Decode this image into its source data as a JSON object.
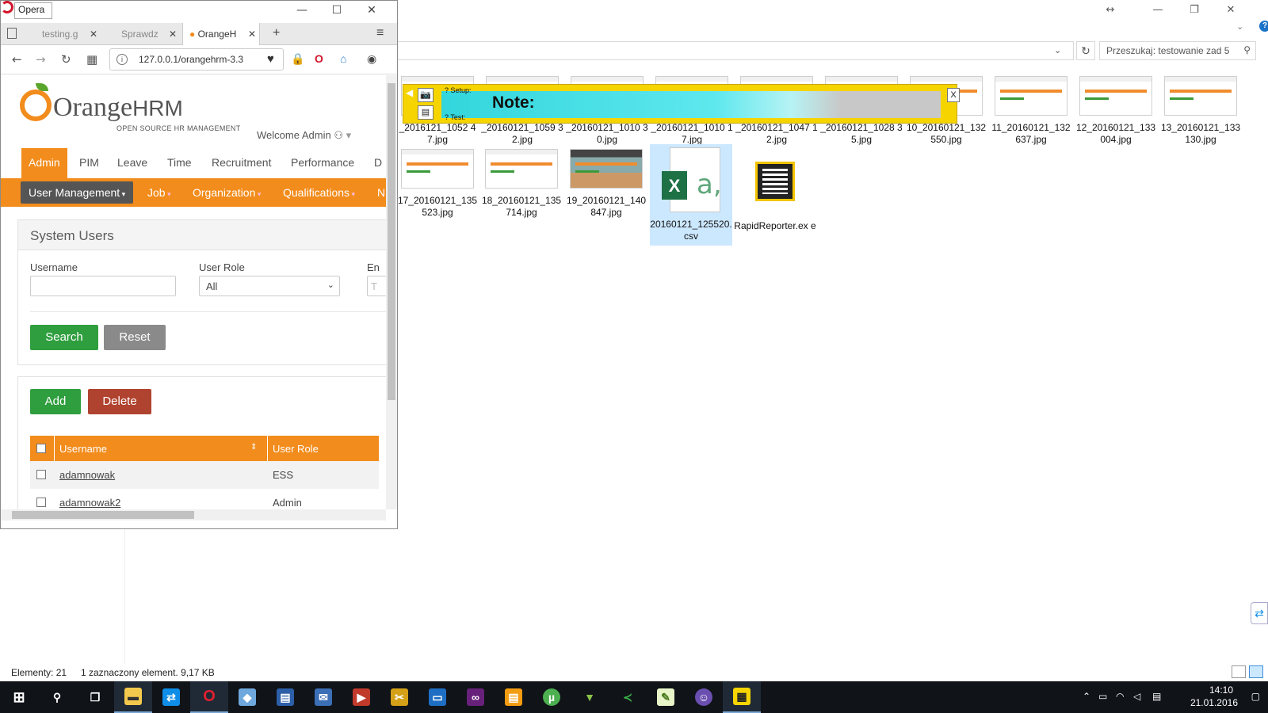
{
  "explorer": {
    "search_placeholder": "Przeszukaj: testowanie zad 5",
    "status_count": "Elementy: 21",
    "status_selected": "1 zaznaczony element. 9,17 KB",
    "row1_files": [
      "_2016121_1052 47.jpg",
      "_20160121_1059 32.jpg",
      "_20160121_1010 30.jpg",
      "_20160121_1010 17.jpg",
      "_20160121_1047 12.jpg",
      "_20160121_1028 35.jpg",
      "10_20160121_132 550.jpg",
      "11_20160121_132 637.jpg",
      "12_20160121_133 004.jpg",
      "13_20160121_133 130.jpg"
    ],
    "row2_files": [
      "17_20160121_135 523.jpg",
      "18_20160121_135 714.jpg",
      "19_20160121_140 847.jpg",
      "20160121_125520. csv",
      "RapidReporter.ex e"
    ]
  },
  "rapidreporter": {
    "setup_label": "? Setup:",
    "test_label": "? Test:",
    "note_label": "Note:",
    "close_label": "X"
  },
  "opera": {
    "title": "Opera",
    "tabs": [
      {
        "label": "testing.g"
      },
      {
        "label": "Sprawdz"
      },
      {
        "label": "OrangeH"
      }
    ],
    "url": "127.0.0.1/orangehrm-3.3"
  },
  "ohrm": {
    "logo_text": "Orange",
    "logo_hrm": "HRM",
    "logo_tagline": "OPEN SOURCE HR MANAGEMENT",
    "welcome": "Welcome Admin",
    "main_menu": [
      "Admin",
      "PIM",
      "Leave",
      "Time",
      "Recruitment",
      "Performance",
      "D"
    ],
    "sub_menu": [
      "User Management",
      "Job",
      "Organization",
      "Qualifications",
      "N"
    ],
    "panel_title": "System Users",
    "labels": {
      "username": "Username",
      "user_role": "User Role",
      "employee": "En"
    },
    "role_value": "All",
    "employee_placeholder": "T",
    "btn_search": "Search",
    "btn_reset": "Reset",
    "btn_add": "Add",
    "btn_delete": "Delete",
    "table_headers": [
      "Username",
      "User Role"
    ],
    "rows": [
      {
        "username": "adamnowak",
        "role": "ESS"
      },
      {
        "username": "adamnowak2",
        "role": "Admin"
      }
    ]
  },
  "taskbar": {
    "time": "14:10",
    "date": "21.01.2016"
  },
  "colors": {
    "orange": "#f28c1c",
    "green": "#2f9e3e",
    "red": "#b0432f",
    "rr_yellow": "#f5d400"
  }
}
